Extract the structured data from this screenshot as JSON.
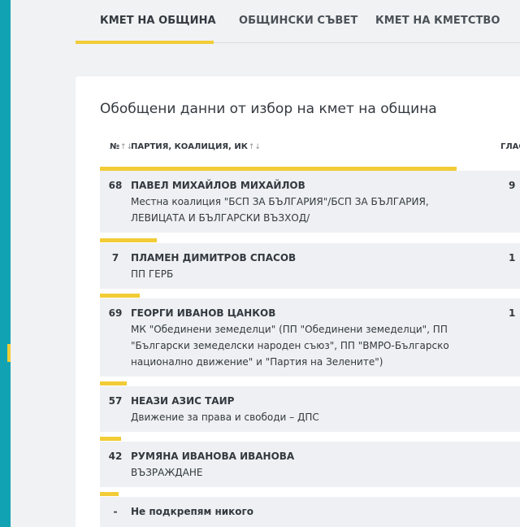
{
  "tabs": [
    {
      "label": "КМЕТ НА ОБЩИНА",
      "active": true
    },
    {
      "label": "ОБЩИНСКИ СЪВЕТ",
      "active": false
    },
    {
      "label": "КМЕТ НА КМЕТСТВО",
      "active": false
    }
  ],
  "card": {
    "title": "Обобщени данни от избор на кмет на община",
    "columns": {
      "number": "№",
      "party": "ПАРТИЯ, КОАЛИЦИЯ, ИК",
      "votes": "ГЛАС"
    }
  },
  "rows": [
    {
      "number": "68",
      "name": "ПАВЕЛ МИХАЙЛОВ МИХАЙЛОВ",
      "party": "Местна коалиция \"БСП ЗА БЪЛГАРИЯ\"/БСП ЗА БЪЛГАРИЯ, ЛЕВИЦАТА И БЪЛГАРСКИ ВЪЗХОД/",
      "votes": "9",
      "bar_fraction": 0.85
    },
    {
      "number": "7",
      "name": "ПЛАМЕН ДИМИТРОВ СПАСОВ",
      "party": "ПП ГЕРБ",
      "votes": "1",
      "bar_fraction": 0.135
    },
    {
      "number": "69",
      "name": "ГЕОРГИ ИВАНОВ ЦАНКОВ",
      "party": "МК \"Обединени земеделци\" (ПП \"Обединени земеделци\", ПП \"Български земеделски народен съюз\", ПП \"ВМРО-Българско национално движение\" и \"Партия на Зелените\")",
      "votes": "1",
      "bar_fraction": 0.095
    },
    {
      "number": "57",
      "name": "НЕАЗИ АЗИС ТАИР",
      "party": "Движение за права и свободи – ДПС",
      "votes": "",
      "bar_fraction": 0.064
    },
    {
      "number": "42",
      "name": "РУМЯНА ИВАНОВА ИВАНОВА",
      "party": "ВЪЗРАЖДАНЕ",
      "votes": "",
      "bar_fraction": 0.05
    },
    {
      "number": "-",
      "name": "Не подкрепям никого",
      "party": "",
      "votes": "",
      "bar_fraction": 0.045
    }
  ],
  "colors": {
    "accent": "#f2cc36",
    "rail": "#11a3b4",
    "row_bg": "#eef0f3"
  }
}
